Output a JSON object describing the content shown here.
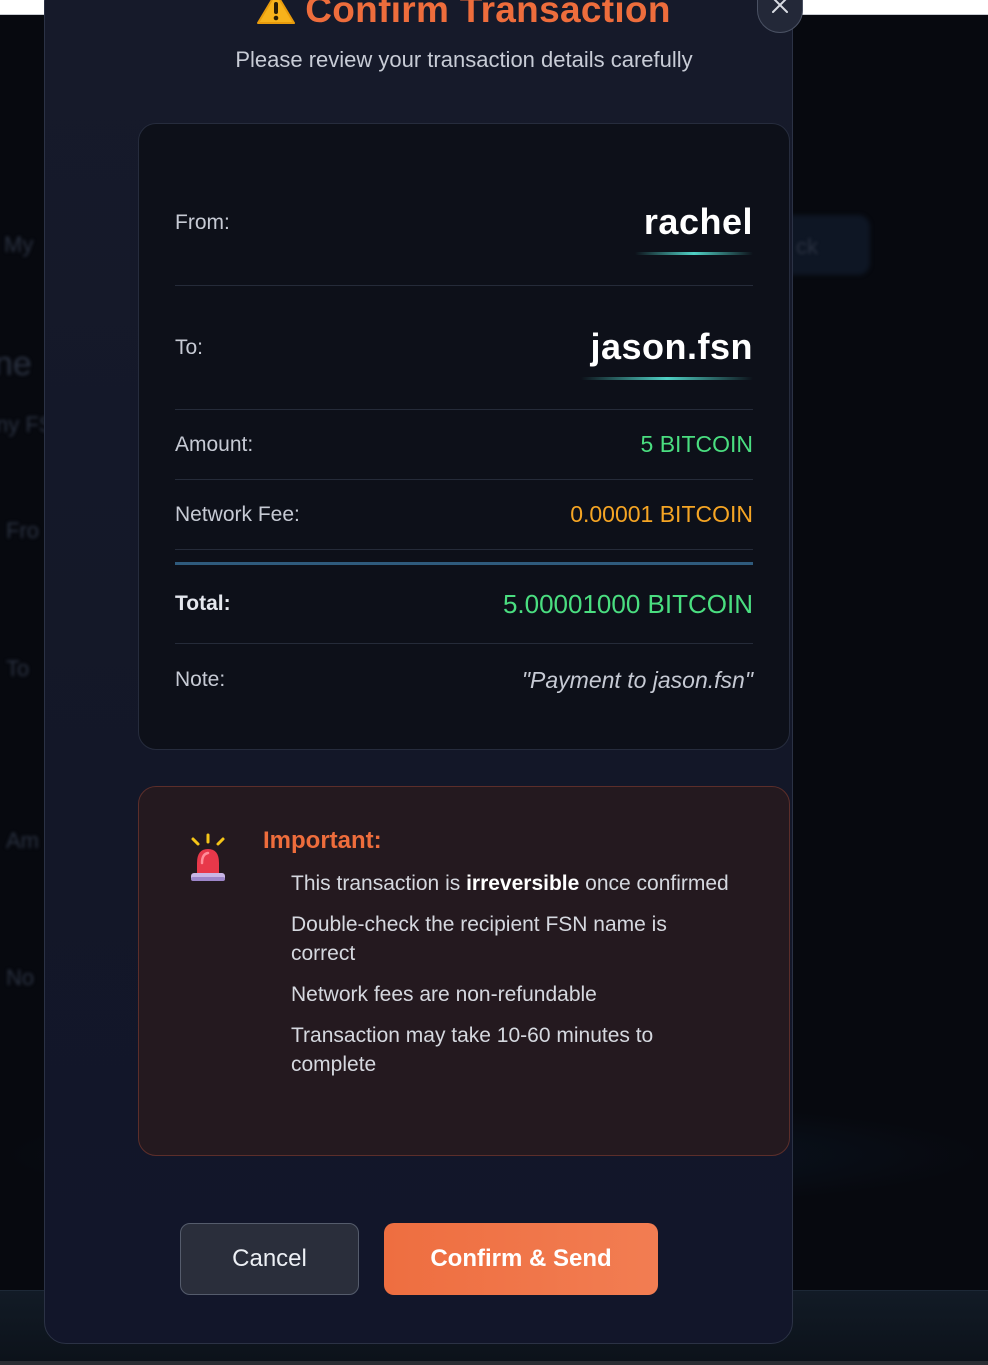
{
  "colors": {
    "accent_orange": "#ee6d3c",
    "amount_green": "#4ade80",
    "fee_amber": "#f5a524",
    "modal_bg": "#161a2a",
    "card_bg": "#0d1019",
    "warning_bg": "#24191f"
  },
  "modal": {
    "title_icon": "warning-icon",
    "title": "Confirm Transaction",
    "subtitle": "Please review your transaction details carefully",
    "close_icon": "close-icon"
  },
  "details": {
    "from_label": "From:",
    "from_value": "rachel",
    "to_label": "To:",
    "to_value": "jason.fsn",
    "amount_label": "Amount:",
    "amount_value": "5 BITCOIN",
    "fee_label": "Network Fee:",
    "fee_value": "0.00001 BITCOIN",
    "total_label": "Total:",
    "total_value": "5.00001000 BITCOIN",
    "note_label": "Note:",
    "note_value": "\"Payment to jason.fsn\""
  },
  "warning": {
    "icon": "siren-icon",
    "title": "Important:",
    "item1_pre": "This transaction is ",
    "item1_bold": "irreversible",
    "item1_post": " once confirmed",
    "item2": "Double-check the recipient FSN name is correct",
    "item3": "Network fees are non-refundable",
    "item4": "Transaction may take 10-60 minutes to complete"
  },
  "actions": {
    "cancel_label": "Cancel",
    "confirm_label": "Confirm & Send"
  }
}
